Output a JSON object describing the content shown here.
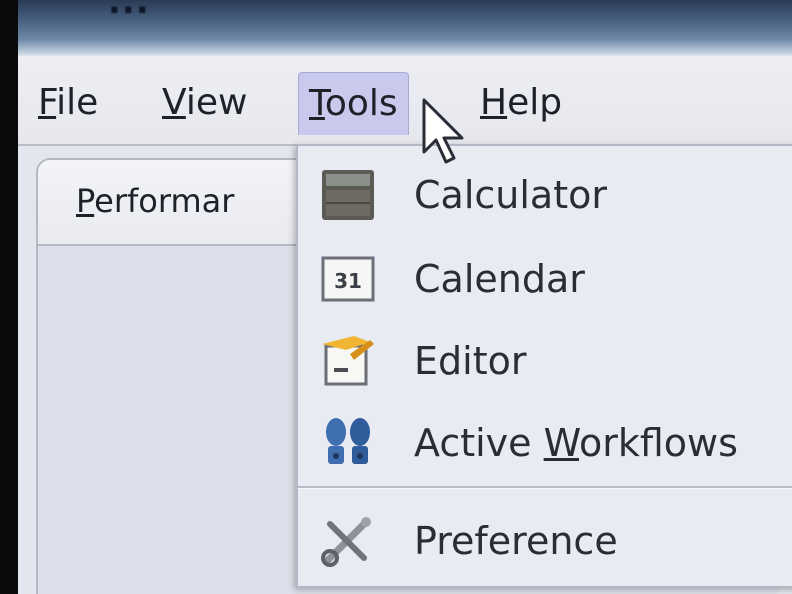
{
  "window": {
    "title_fragment": "..."
  },
  "menubar": {
    "items": [
      {
        "label": "File",
        "mnemonic_index": 0
      },
      {
        "label": "View",
        "mnemonic_index": 0
      },
      {
        "label": "Tools",
        "mnemonic_index": 0
      },
      {
        "label": "Help",
        "mnemonic_index": 0
      }
    ],
    "open_menu": "Tools"
  },
  "tabs": {
    "items": [
      {
        "label": "Performar"
      }
    ]
  },
  "tools_menu": {
    "items": [
      {
        "label": "Calculator",
        "icon": "calculator-icon"
      },
      {
        "label": "Calendar",
        "icon": "calendar-icon",
        "icon_text": "31"
      },
      {
        "label": "Editor",
        "icon": "editor-icon"
      },
      {
        "label": "Active Workflows",
        "label_pre": "Active ",
        "label_mn": "W",
        "label_post": "orkflows",
        "icon": "workflows-icon"
      },
      {
        "label": "Preference",
        "icon": "preference-icon"
      }
    ]
  },
  "colors": {
    "menu_highlight": "#c8c9ec",
    "menu_bg": "#e9ebf2",
    "text": "#2a2d36"
  }
}
